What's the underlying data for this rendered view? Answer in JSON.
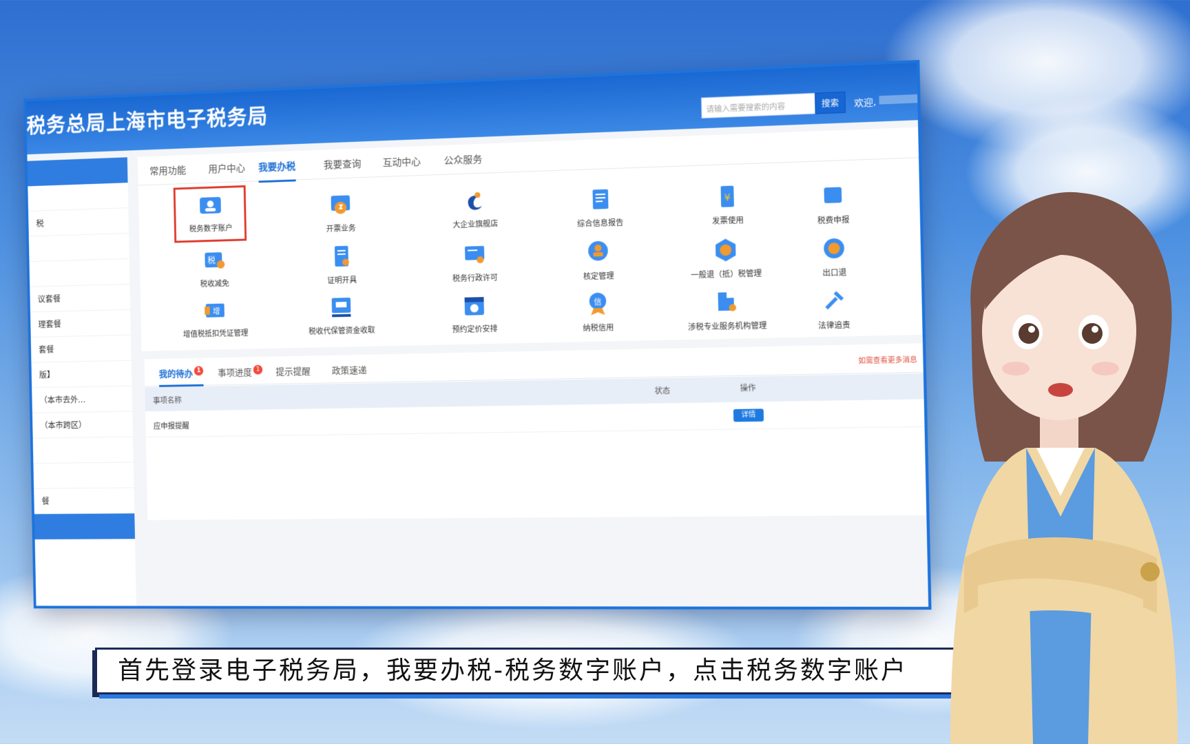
{
  "site": {
    "title": "税务总局上海市电子税务局",
    "search_placeholder": "请输入需要搜索的内容",
    "search_button": "搜索",
    "welcome": "欢迎,"
  },
  "sidebar": {
    "items": [
      "",
      "",
      "税",
      "",
      "",
      "议套餐",
      "理套餐",
      "套餐",
      "版】",
      "（本市去外...",
      "（本市跨区）",
      "",
      "",
      "餐",
      "",
      ""
    ]
  },
  "nav_tabs": [
    "常用功能",
    "用户中心",
    "我要办税",
    "我要查询",
    "互动中心",
    "公众服务"
  ],
  "active_tab": "我要办税",
  "services": [
    {
      "label": "税务数字账户",
      "icon": "digital-account-icon",
      "highlighted": true
    },
    {
      "label": "开票业务",
      "icon": "invoice-issue-icon"
    },
    {
      "label": "大企业旗舰店",
      "icon": "enterprise-flagship-icon"
    },
    {
      "label": "综合信息报告",
      "icon": "info-report-icon"
    },
    {
      "label": "发票使用",
      "icon": "invoice-use-icon"
    },
    {
      "label": "税费申报",
      "icon": "tax-declaration-icon"
    },
    {
      "label": "税收减免",
      "icon": "tax-reduction-icon"
    },
    {
      "label": "证明开具",
      "icon": "certificate-icon"
    },
    {
      "label": "税务行政许可",
      "icon": "admin-license-icon"
    },
    {
      "label": "核定管理",
      "icon": "assessment-icon"
    },
    {
      "label": "一般退（抵）税管理",
      "icon": "refund-icon"
    },
    {
      "label": "出口退",
      "icon": "export-refund-icon"
    },
    {
      "label": "增值税抵扣凭证管理",
      "icon": "vat-voucher-icon"
    },
    {
      "label": "税收代保管资金收取",
      "icon": "custody-funds-icon"
    },
    {
      "label": "预约定价安排",
      "icon": "pricing-arrangement-icon"
    },
    {
      "label": "纳税信用",
      "icon": "tax-credit-icon"
    },
    {
      "label": "涉税专业服务机构管理",
      "icon": "tax-agency-icon"
    },
    {
      "label": "法律追责",
      "icon": "legal-icon"
    }
  ],
  "todo": {
    "tabs": [
      {
        "label": "我的待办",
        "badge": "1"
      },
      {
        "label": "事项进度",
        "badge": "1"
      },
      {
        "label": "提示提醒"
      },
      {
        "label": "政策速递"
      }
    ],
    "more_link": "如需查看更多消息",
    "columns": {
      "name": "事项名称",
      "status": "状态",
      "action": "操作"
    },
    "rows": [
      {
        "name": "应申报提醒",
        "status": "",
        "action": "详情"
      }
    ]
  },
  "subtitle": "首先登录电子税务局，我要办税-税务数字账户，点击税务数字账户",
  "colors": {
    "primary": "#1e6fd6",
    "highlight_border": "#e03a2c",
    "badge": "#f24a3a"
  }
}
